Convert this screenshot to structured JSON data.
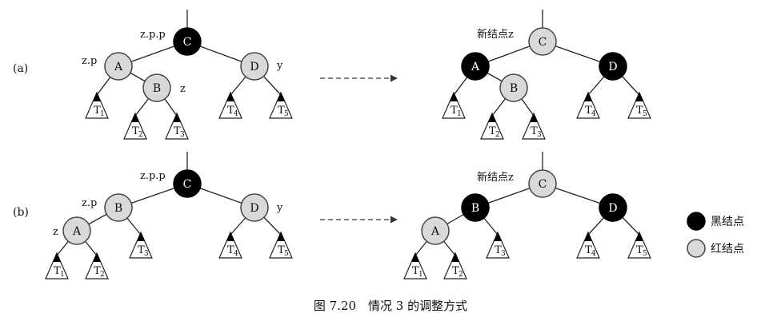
{
  "labels": {
    "row_a": "(a)",
    "row_b": "(b)",
    "zpp": "z.p.p",
    "zp": "z.p",
    "z": "z",
    "y": "y",
    "new_z": "新结点z",
    "caption": "图 7.20　情况 3 的调整方式"
  },
  "legend": {
    "black": "黑结点",
    "red": "红结点"
  },
  "colors": {
    "black": "#000000",
    "red_fill": "#d9d9d9"
  },
  "nodes": {
    "A": "A",
    "B": "B",
    "C": "C",
    "D": "D"
  },
  "subtrees": {
    "T1": {
      "t": "T",
      "s": "1"
    },
    "T2": {
      "t": "T",
      "s": "2"
    },
    "T3": {
      "t": "T",
      "s": "3"
    },
    "T4": {
      "t": "T",
      "s": "4"
    },
    "T5": {
      "t": "T",
      "s": "5"
    }
  }
}
